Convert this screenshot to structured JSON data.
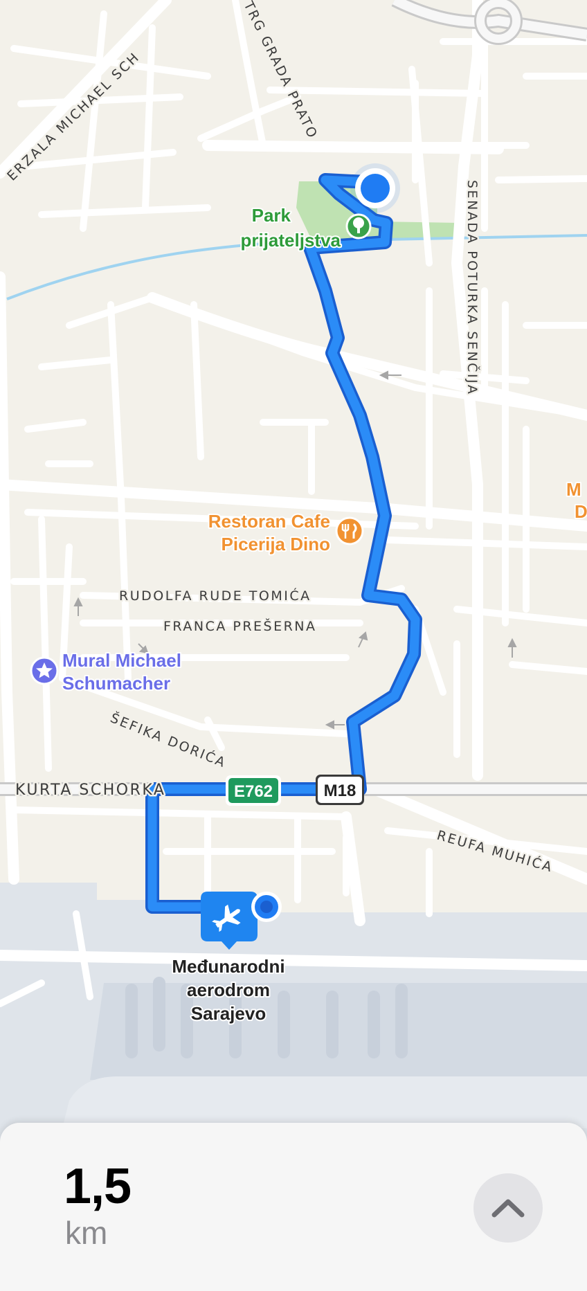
{
  "map": {
    "streets": {
      "zmaja_michael": "ERZALA MICHAEL SCH",
      "trg_prato": "TRG GRADA PRATO",
      "senada": "SENADA POTURKA SENČIJA",
      "rudolfa": "RUDOLFA RUDE TOMIĆA",
      "franca": "FRANCA PREŠERNA",
      "sefika": "ŠEFIKA DORIĆA",
      "kurta": "KURTA SCHORKA",
      "reufa": "REUFA MUHIĆA"
    },
    "shields": {
      "e762": "E762",
      "m18": "M18"
    },
    "pois": {
      "park": {
        "line1": "Park",
        "line2": "prijateljstva",
        "icon": "tree-icon",
        "color": "#2e9b3a"
      },
      "restaurant": {
        "line1": "Restoran Cafe",
        "line2": "Picerija Dino",
        "icon": "fork-knife-icon",
        "color": "#f19231"
      },
      "mural": {
        "line1": "Mural Michael",
        "line2": "Schumacher",
        "icon": "star-icon",
        "color": "#6a6ee8"
      },
      "airport": {
        "line1": "Međunarodni",
        "line2": "aerodrom",
        "line3": "Sarajevo",
        "icon": "airplane-icon",
        "color": "#1f85f0"
      },
      "partial_right": {
        "line1": "M",
        "line2": "D"
      }
    },
    "route_color": "#1f7cf3",
    "route_outline_color": "#1a5fd0"
  },
  "card": {
    "distance_value": "1,5",
    "distance_unit": "km",
    "expand_icon": "chevron-up-icon"
  }
}
